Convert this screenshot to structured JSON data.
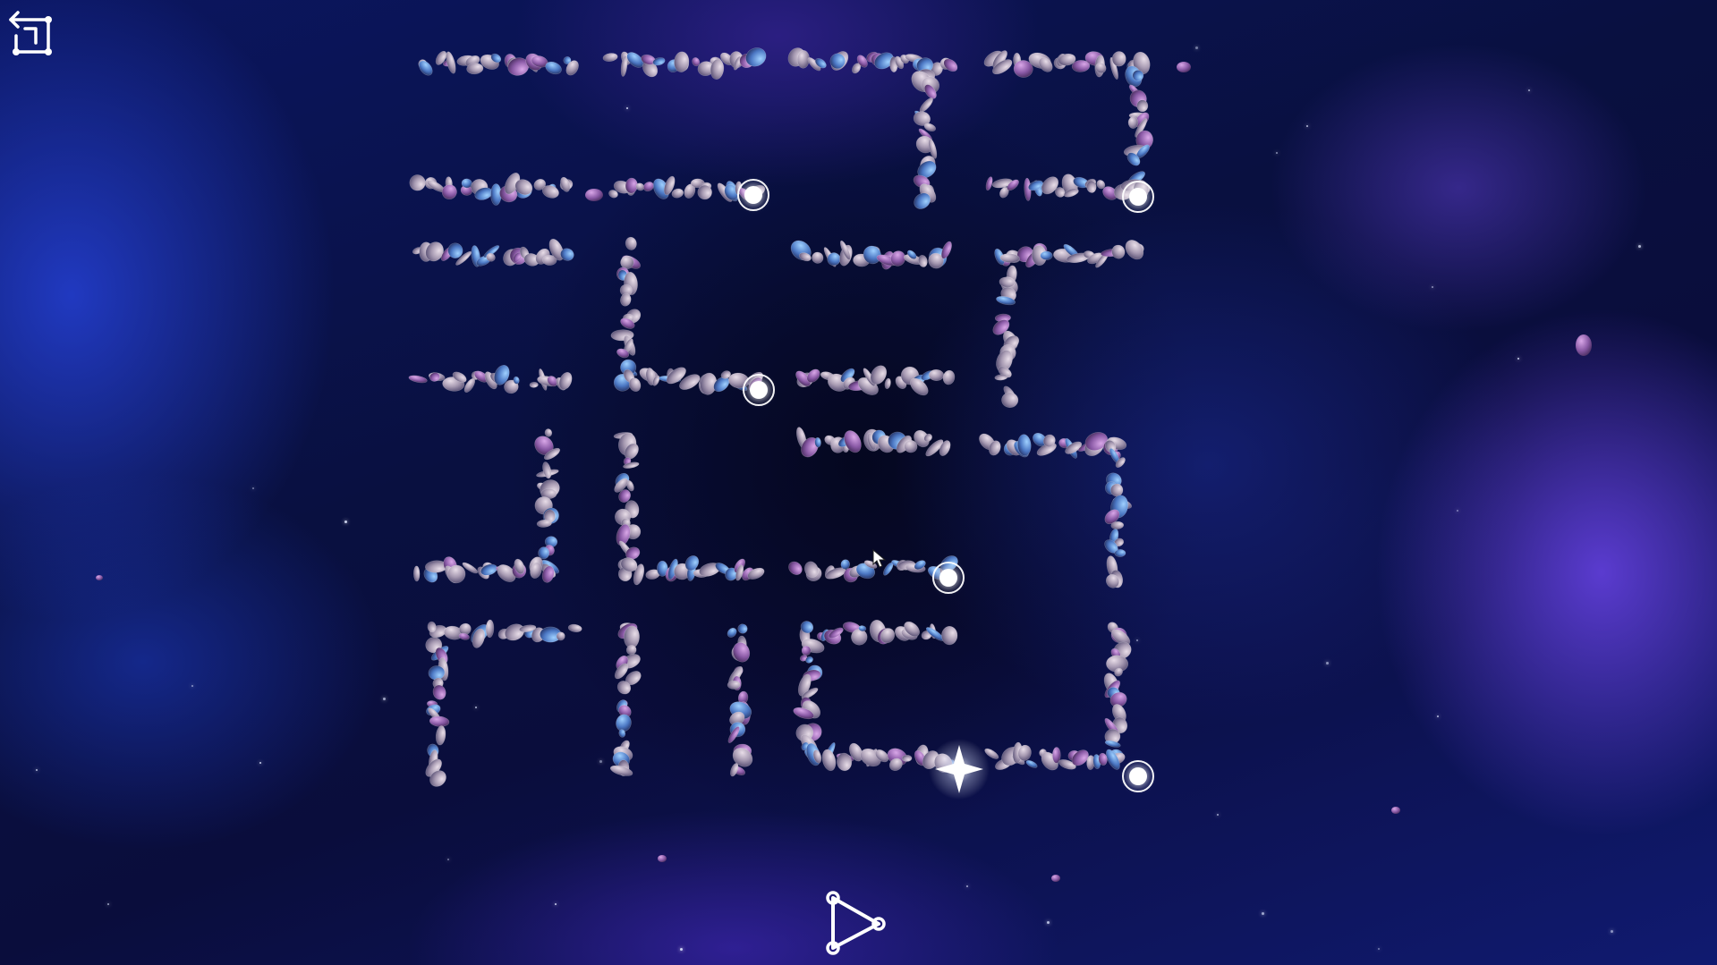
{
  "game": {
    "screen": "puzzle-level",
    "accent_color": "#ffffff",
    "nebula_colors": [
      "#2846e6",
      "#6e46f0",
      "#0a0d3c"
    ]
  },
  "controls": {
    "undo_icon": "undo-arrow-icon",
    "play_icon": "play-triangle-icon"
  },
  "board": {
    "rows": 4,
    "columns": 4,
    "tile_style": "asteroid-rock-outline",
    "active_nodes": 6,
    "goal_icon": "four-point-star-icon"
  }
}
